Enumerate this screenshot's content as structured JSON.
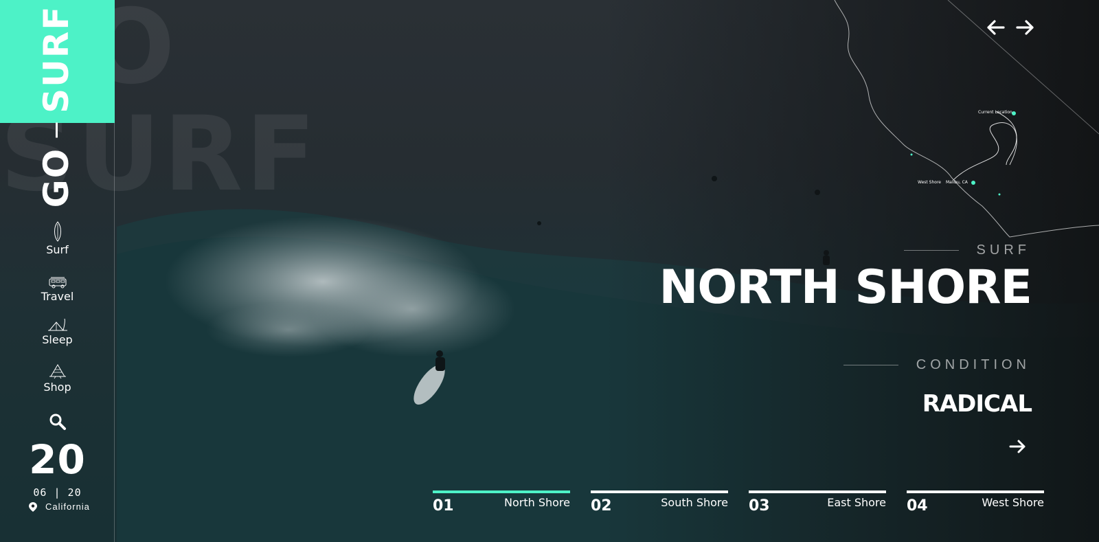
{
  "brand": {
    "word1": "GO",
    "word2": "SURF",
    "ghost_word1": "GO",
    "ghost_word2": "SURF",
    "accent": "#4df2c7"
  },
  "sidebar": {
    "nav": [
      {
        "label": "Surf",
        "icon": "surfboard-icon"
      },
      {
        "label": "Travel",
        "icon": "van-icon"
      },
      {
        "label": "Sleep",
        "icon": "tent-icon"
      },
      {
        "label": "Shop",
        "icon": "shop-icon"
      }
    ],
    "search_icon": "search-icon",
    "date": {
      "day": "20",
      "month_year": "06 | 20",
      "location": "California",
      "location_icon": "location-pin-icon"
    }
  },
  "header": {
    "prev_icon": "arrow-left-icon",
    "next_icon": "arrow-right-icon"
  },
  "map": {
    "labels": {
      "current_location": "Current Location",
      "west_shore": "West Shore",
      "malibu": "Malibu, CA"
    }
  },
  "hero": {
    "kicker": "SURF",
    "title": "NORTH SHORE",
    "condition_kicker": "CONDITION",
    "condition": "RADICAL",
    "cta_icon": "arrow-right-icon"
  },
  "tabs": [
    {
      "num": "01",
      "name": "North Shore",
      "active": true
    },
    {
      "num": "02",
      "name": "South Shore",
      "active": false
    },
    {
      "num": "03",
      "name": "East Shore",
      "active": false
    },
    {
      "num": "04",
      "name": "West Shore",
      "active": false
    }
  ]
}
